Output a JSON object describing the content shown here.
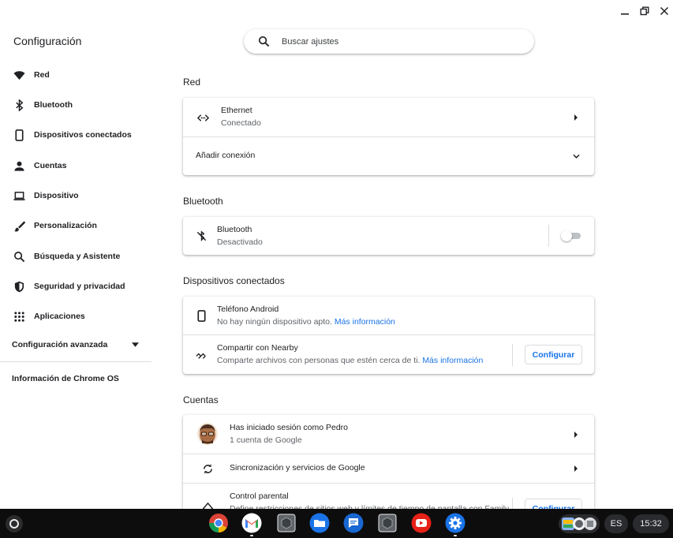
{
  "app": {
    "title": "Configuración"
  },
  "search": {
    "placeholder": "Buscar ajustes"
  },
  "sidebar": {
    "items": [
      {
        "label": "Red",
        "icon": "wifi-icon"
      },
      {
        "label": "Bluetooth",
        "icon": "bluetooth-icon"
      },
      {
        "label": "Dispositivos conectados",
        "icon": "phone-icon"
      },
      {
        "label": "Cuentas",
        "icon": "person-icon"
      },
      {
        "label": "Dispositivo",
        "icon": "laptop-icon"
      },
      {
        "label": "Personalización",
        "icon": "brush-icon"
      },
      {
        "label": "Búsqueda y Asistente",
        "icon": "search-icon"
      },
      {
        "label": "Seguridad y privacidad",
        "icon": "shield-icon"
      },
      {
        "label": "Aplicaciones",
        "icon": "apps-grid-icon"
      }
    ],
    "advanced": "Configuración avanzada",
    "about": "Información de Chrome OS"
  },
  "sections": {
    "network": {
      "title": "Red",
      "ethernet_title": "Ethernet",
      "ethernet_status": "Conectado",
      "add_connection": "Añadir conexión"
    },
    "bluetooth": {
      "title": "Bluetooth",
      "row_title": "Bluetooth",
      "row_status": "Desactivado",
      "enabled": false
    },
    "connected": {
      "title": "Dispositivos conectados",
      "android_title": "Teléfono Android",
      "android_sub": "No hay ningún dispositivo apto.",
      "android_link": "Más información",
      "nearby_title": "Compartir con Nearby",
      "nearby_sub": "Comparte archivos con personas que estén cerca de ti.",
      "nearby_link": "Más información",
      "nearby_button": "Configurar"
    },
    "accounts": {
      "title": "Cuentas",
      "signed_in_title": "Has iniciado sesión como Pedro",
      "signed_in_sub": "1 cuenta de Google",
      "sync_title": "Sincronización y servicios de Google",
      "parental_title": "Control parental",
      "parental_sub": "Define restricciones de sitios web y límites de tiempo de pantalla con Family",
      "parental_button": "Configurar"
    }
  },
  "shelf": {
    "apps": [
      "chrome-icon",
      "gmail-icon",
      "app-cube-icon",
      "files-icon",
      "messages-icon",
      "app-cube-icon",
      "youtube-icon",
      "settings-gear-icon"
    ],
    "ime": "ES",
    "time": "15:32"
  },
  "colors": {
    "accent": "#1a73e8",
    "text": "#202124",
    "secondary": "#5f6368",
    "shelf": "#0d0d0d"
  }
}
